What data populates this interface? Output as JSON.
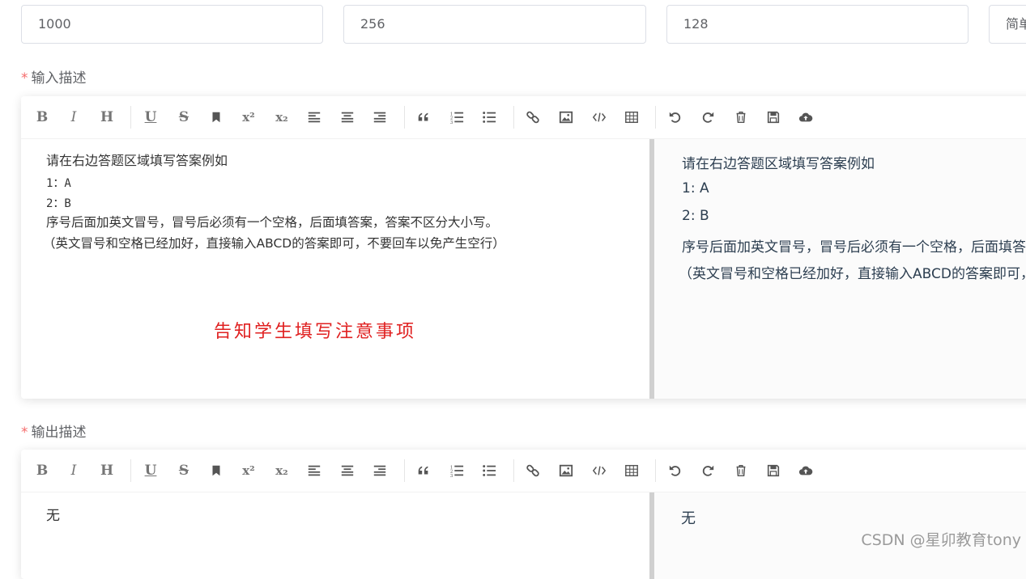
{
  "top_inputs": [
    {
      "value": "1000"
    },
    {
      "value": "256"
    },
    {
      "value": "128"
    },
    {
      "value": "简单"
    }
  ],
  "required_mark": "*",
  "input_section": {
    "label": "输入描述",
    "editor": {
      "left_lines": [
        "请在右边答题区域填写答案例如",
        "1：A",
        "2：B",
        "序号后面加英文冒号，冒号后必须有一个空格，后面填答案，答案不区分大小写。",
        "（英文冒号和空格已经加好，直接输入ABCD的答案即可，不要回车以免产生空行）"
      ],
      "note": "告知学生填写注意事项",
      "right_lines": [
        "请在右边答题区域填写答案例如",
        "1: A",
        "2: B",
        "序号后面加英文冒号，冒号后必须有一个空格，后面填答案，答案不区分大小写。",
        "（英文冒号和空格已经加好，直接输入ABCD的答案即可，不要回车以免产生空行）"
      ]
    }
  },
  "output_section": {
    "label": "输出描述",
    "editor": {
      "left_lines": [
        "无"
      ],
      "right_lines": [
        "无"
      ]
    }
  },
  "toolbar": {
    "bold": "B",
    "italic": "I",
    "heading": "H",
    "underline": "U",
    "strike": "S",
    "superscript": "x²",
    "subscript": "x₂"
  },
  "watermark": "CSDN @星卯教育tony"
}
